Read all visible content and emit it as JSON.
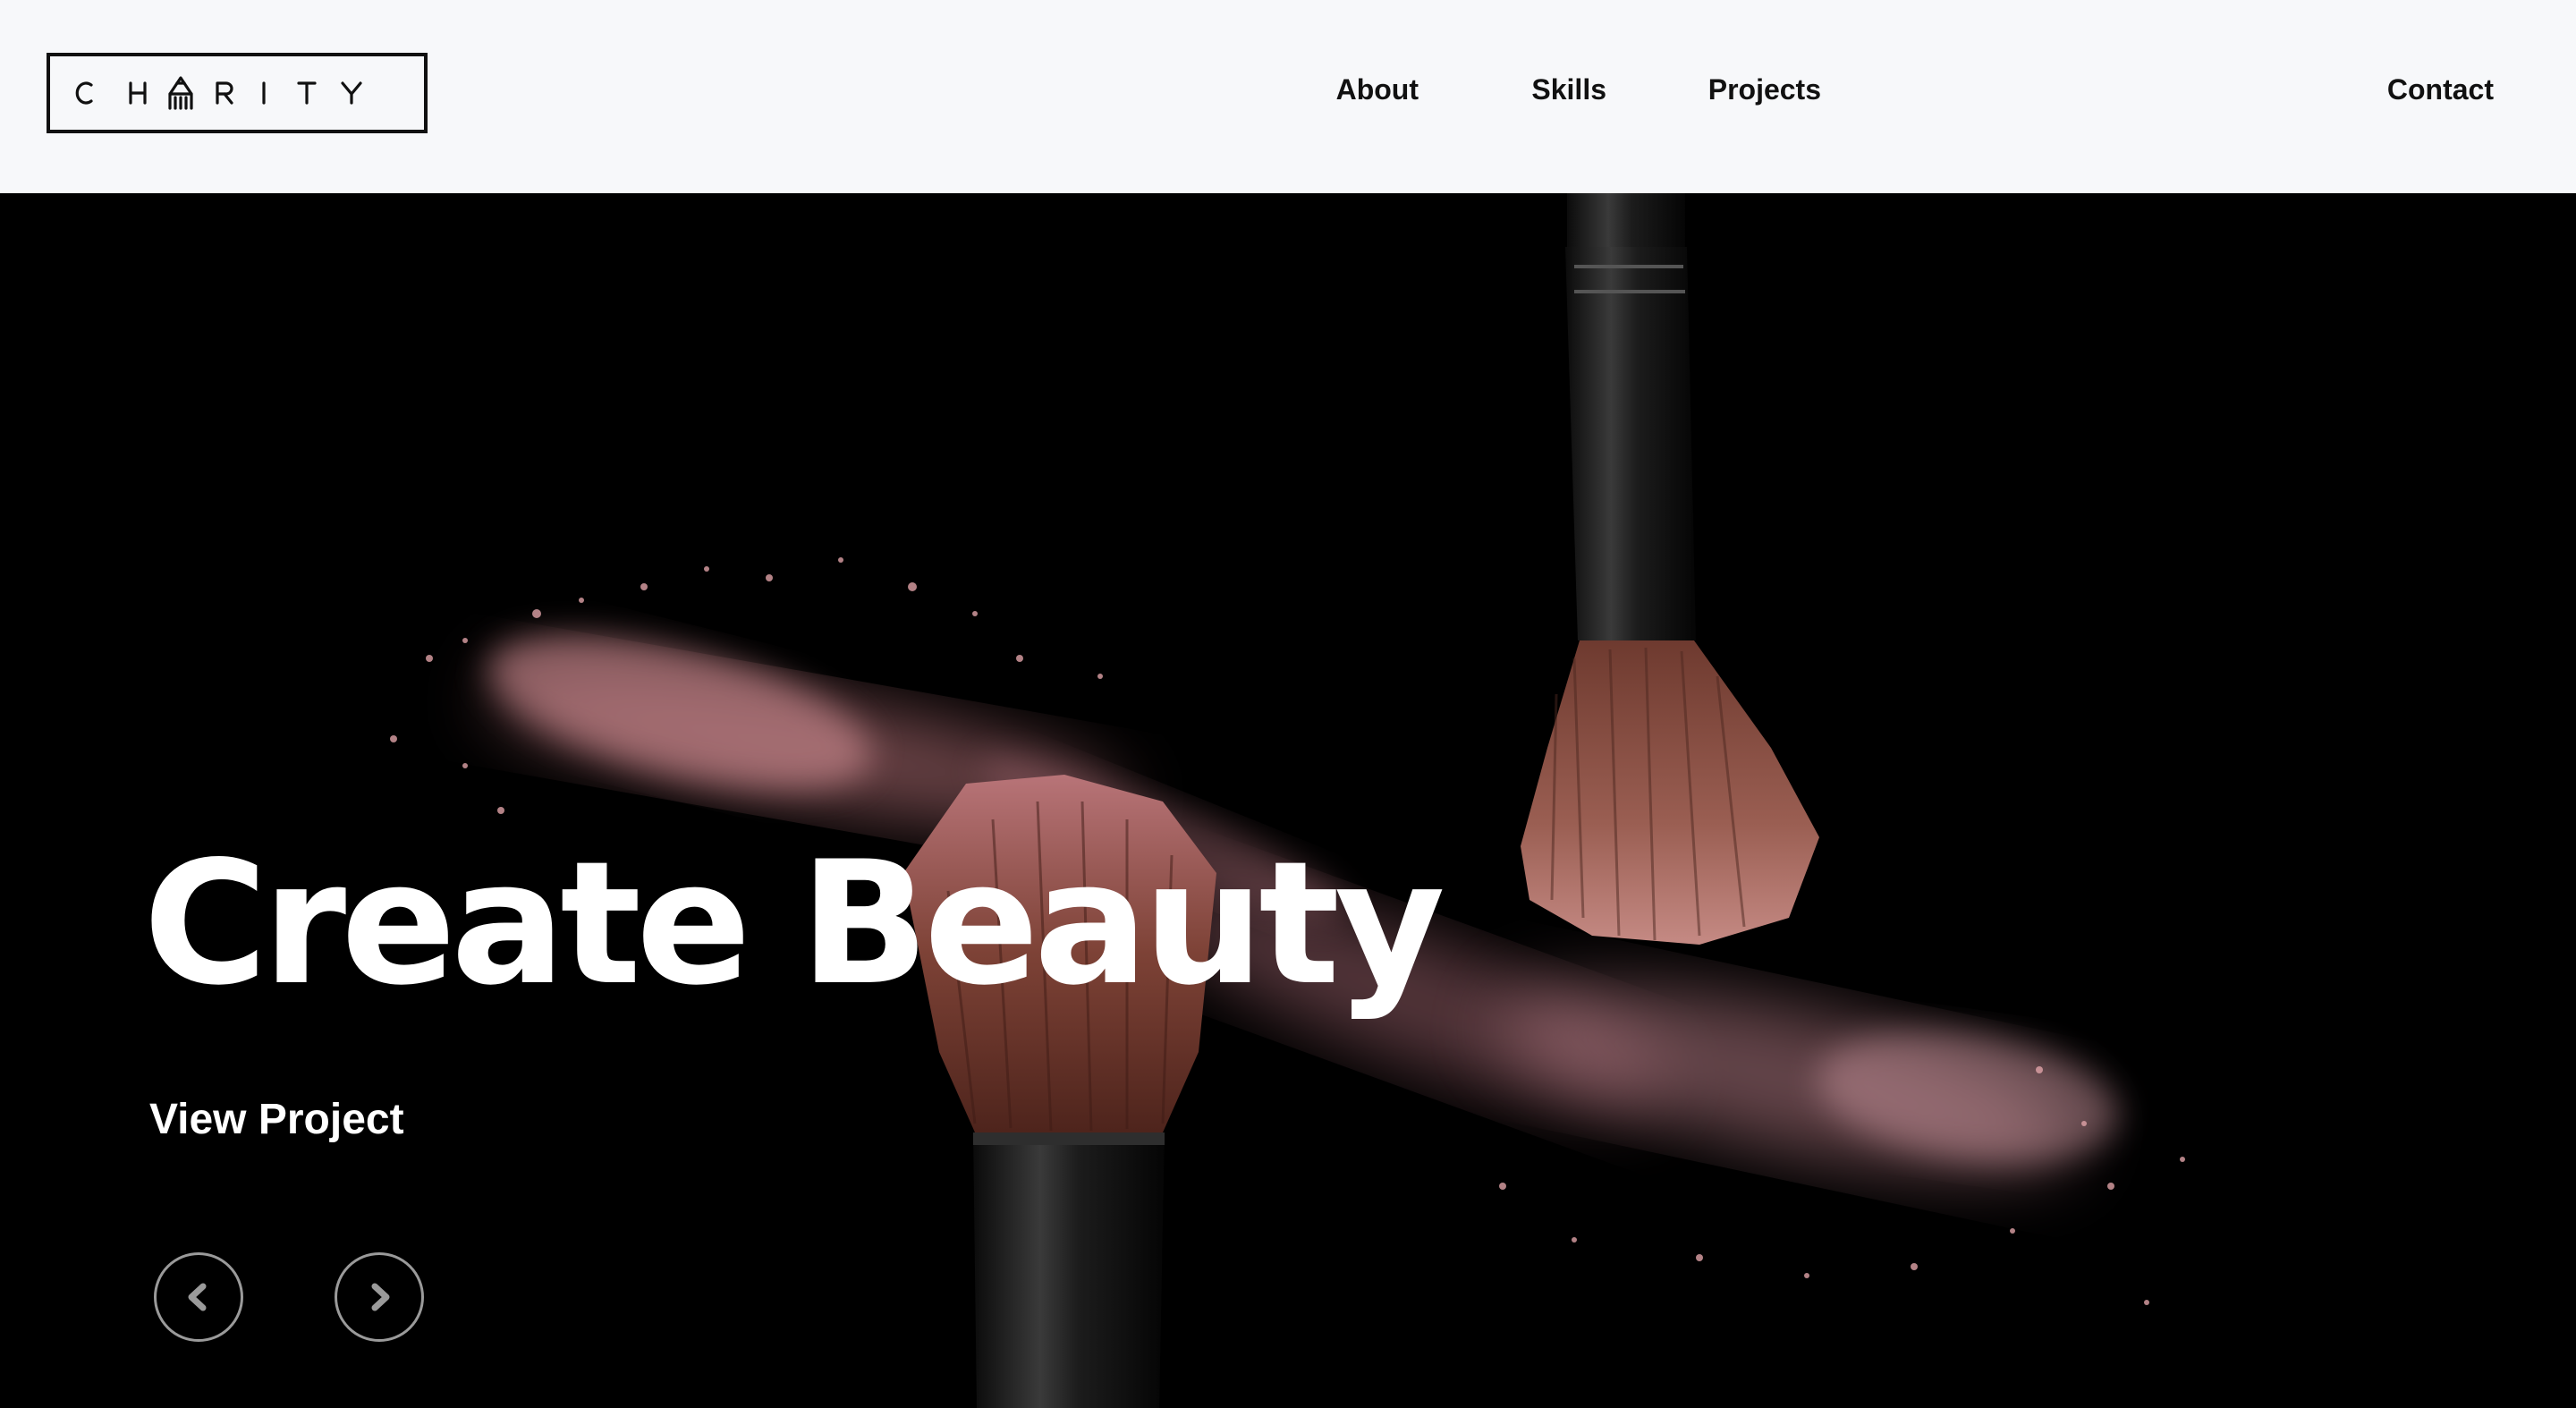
{
  "header": {
    "logo_text": "CHARITY",
    "nav": [
      "About",
      "Skills",
      "Projects",
      "Contact"
    ]
  },
  "hero": {
    "title": "Create Beauty",
    "cta_label": "View Project",
    "prev_icon": "chevron-left-icon",
    "next_icon": "chevron-right-icon"
  },
  "colors": {
    "header_bg": "#f7f8fa",
    "hero_bg": "#000000",
    "text_dark": "#111111",
    "text_light": "#ffffff",
    "powder_pink": "#c98288",
    "bristle_brown": "#8a4f45",
    "handle_black": "#161616"
  }
}
